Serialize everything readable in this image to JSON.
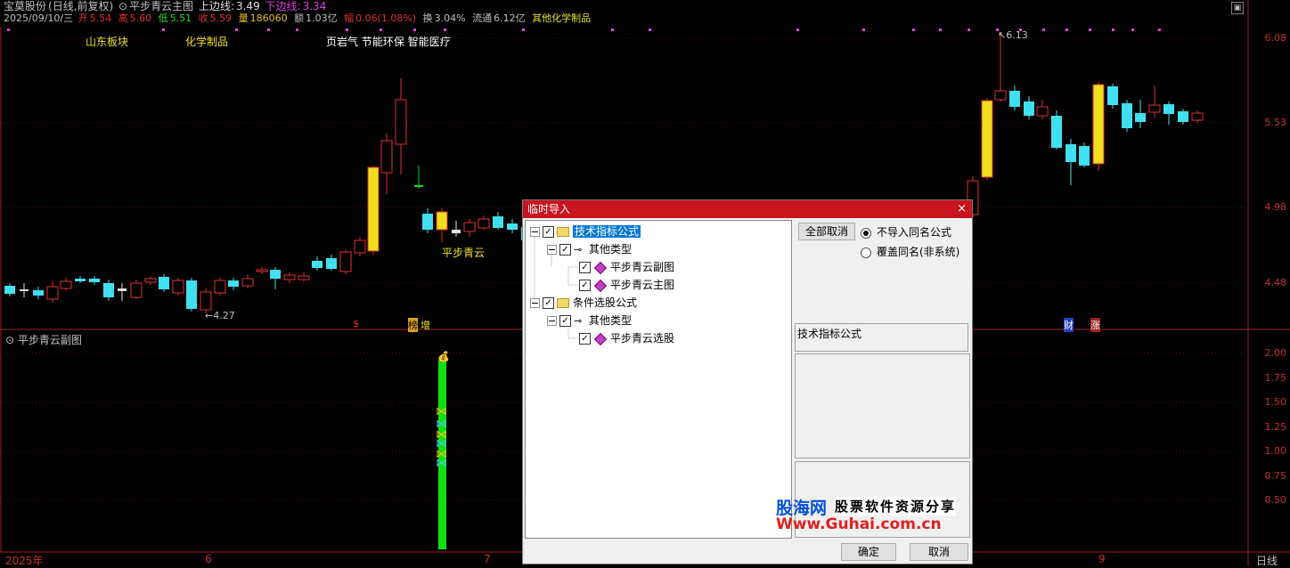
{
  "header": {
    "stock_name": "宝莫股份",
    "period": "(日线,前复权)",
    "indicator_name": "平步青云主图",
    "upper_line_label": "上边线:",
    "upper_line_value": "3.49",
    "lower_line_label": "下边线:",
    "lower_line_value": "3.34",
    "date": "2025/09/10/三",
    "open_label": "开",
    "open": "5.54",
    "high_label": "高",
    "high": "5.60",
    "low_label": "低",
    "low": "5.51",
    "close_label": "收",
    "close": "5.59",
    "vol_label": "量",
    "vol": "186060",
    "amount_label": "额",
    "amount": "1.03亿",
    "change_label": "幅",
    "change": "0.06(1.08%)",
    "turnover_label": "换",
    "turnover": "3.04%",
    "float_label": "流通",
    "float": "6.12亿",
    "sector": "其他化学制品"
  },
  "main_labels": {
    "sector1": "山东板块",
    "sector2": "化学制品",
    "sector3": "页岩气 节能环保 智能医疗",
    "signal": "平步青云",
    "low_mark": "4.27",
    "high_mark": "6.13",
    "mark_s": "$",
    "mark_bang": "榜",
    "mark_zeng": "增",
    "mark_cai": "财",
    "mark_zhang": "涨"
  },
  "main_axis": [
    "6.08",
    "5.53",
    "4.98",
    "4.48"
  ],
  "sub_chart": {
    "title": "平步青云副图",
    "axis": [
      "2.00",
      "1.75",
      "1.50",
      "1.25",
      "1.00",
      "0.75",
      "0.50"
    ]
  },
  "bottom_axis": {
    "year": "2025年",
    "m6": "6",
    "m7": "7",
    "m9": "9",
    "corner": "日线"
  },
  "dialog": {
    "title": "临时导入",
    "close": "×",
    "tree": {
      "root1": "技术指标公式",
      "root1_child": "其他类型",
      "item1": "平步青云副图",
      "item2": "平步青云主图",
      "root2": "条件选股公式",
      "root2_child": "其他类型",
      "item3": "平步青云选股"
    },
    "cancel_all": "全部取消",
    "radio1": "不导入同名公式",
    "radio2": "覆盖同名(非系统)",
    "info_title": "技术指标公式",
    "ok": "确定",
    "cancel": "取消"
  },
  "watermark": {
    "brand": "股海网",
    "slogan": "股票软件资源分享",
    "url": "Www.Guhai.com.cn"
  },
  "colors": {
    "up": "#e03030",
    "down": "#40e0f0",
    "signal_yellow": "#f0e020",
    "sub_green": "#10e010",
    "dialog_red": "#c8141e"
  }
}
